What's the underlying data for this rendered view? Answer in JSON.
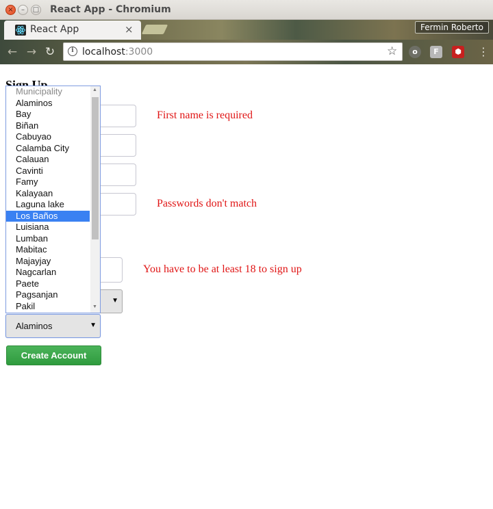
{
  "window": {
    "title": "React App - Chromium",
    "close_glyph": "×",
    "min_glyph": "–",
    "max_glyph": "□"
  },
  "tab": {
    "title": "React App",
    "close_glyph": "×",
    "favicon": "react-atom-icon"
  },
  "profile": {
    "name": "Fermin Roberto"
  },
  "omnibox": {
    "host": "localhost",
    "port": ":3000",
    "info_glyph": "i",
    "star_glyph": "☆"
  },
  "extensions": {
    "o": "o",
    "f": "F",
    "g": "⬢"
  },
  "menu_glyph": "⋮",
  "nav": {
    "back": "←",
    "forward": "→",
    "reload": "↻"
  },
  "page": {
    "heading": "Sign Up",
    "errors": {
      "first_name": "First name is required",
      "password": "Passwords don't match",
      "age": "You have to be at least 18 to sign up"
    },
    "municipality_select": {
      "value": "Alaminos",
      "arrow": "▼"
    },
    "other_select_arrow": "▼",
    "create_button": "Create Account"
  },
  "dropdown": {
    "options": [
      {
        "label": "Municipality",
        "disabled": true
      },
      {
        "label": "Alaminos"
      },
      {
        "label": "Bay"
      },
      {
        "label": "Biñan"
      },
      {
        "label": "Cabuyao"
      },
      {
        "label": "Calamba City"
      },
      {
        "label": "Calauan"
      },
      {
        "label": "Cavinti"
      },
      {
        "label": "Famy"
      },
      {
        "label": "Kalayaan"
      },
      {
        "label": "Laguna lake"
      },
      {
        "label": "Los Baños",
        "selected": true
      },
      {
        "label": "Luisiana"
      },
      {
        "label": "Lumban"
      },
      {
        "label": "Mabitac"
      },
      {
        "label": "Majayjay"
      },
      {
        "label": "Nagcarlan"
      },
      {
        "label": "Paete"
      },
      {
        "label": "Pagsanjan"
      },
      {
        "label": "Pakil"
      }
    ],
    "scroll_up": "▲",
    "scroll_down": "▼"
  },
  "colors": {
    "error": "#e01515",
    "highlight": "#3a81f2",
    "button": "#2f9b3e"
  }
}
